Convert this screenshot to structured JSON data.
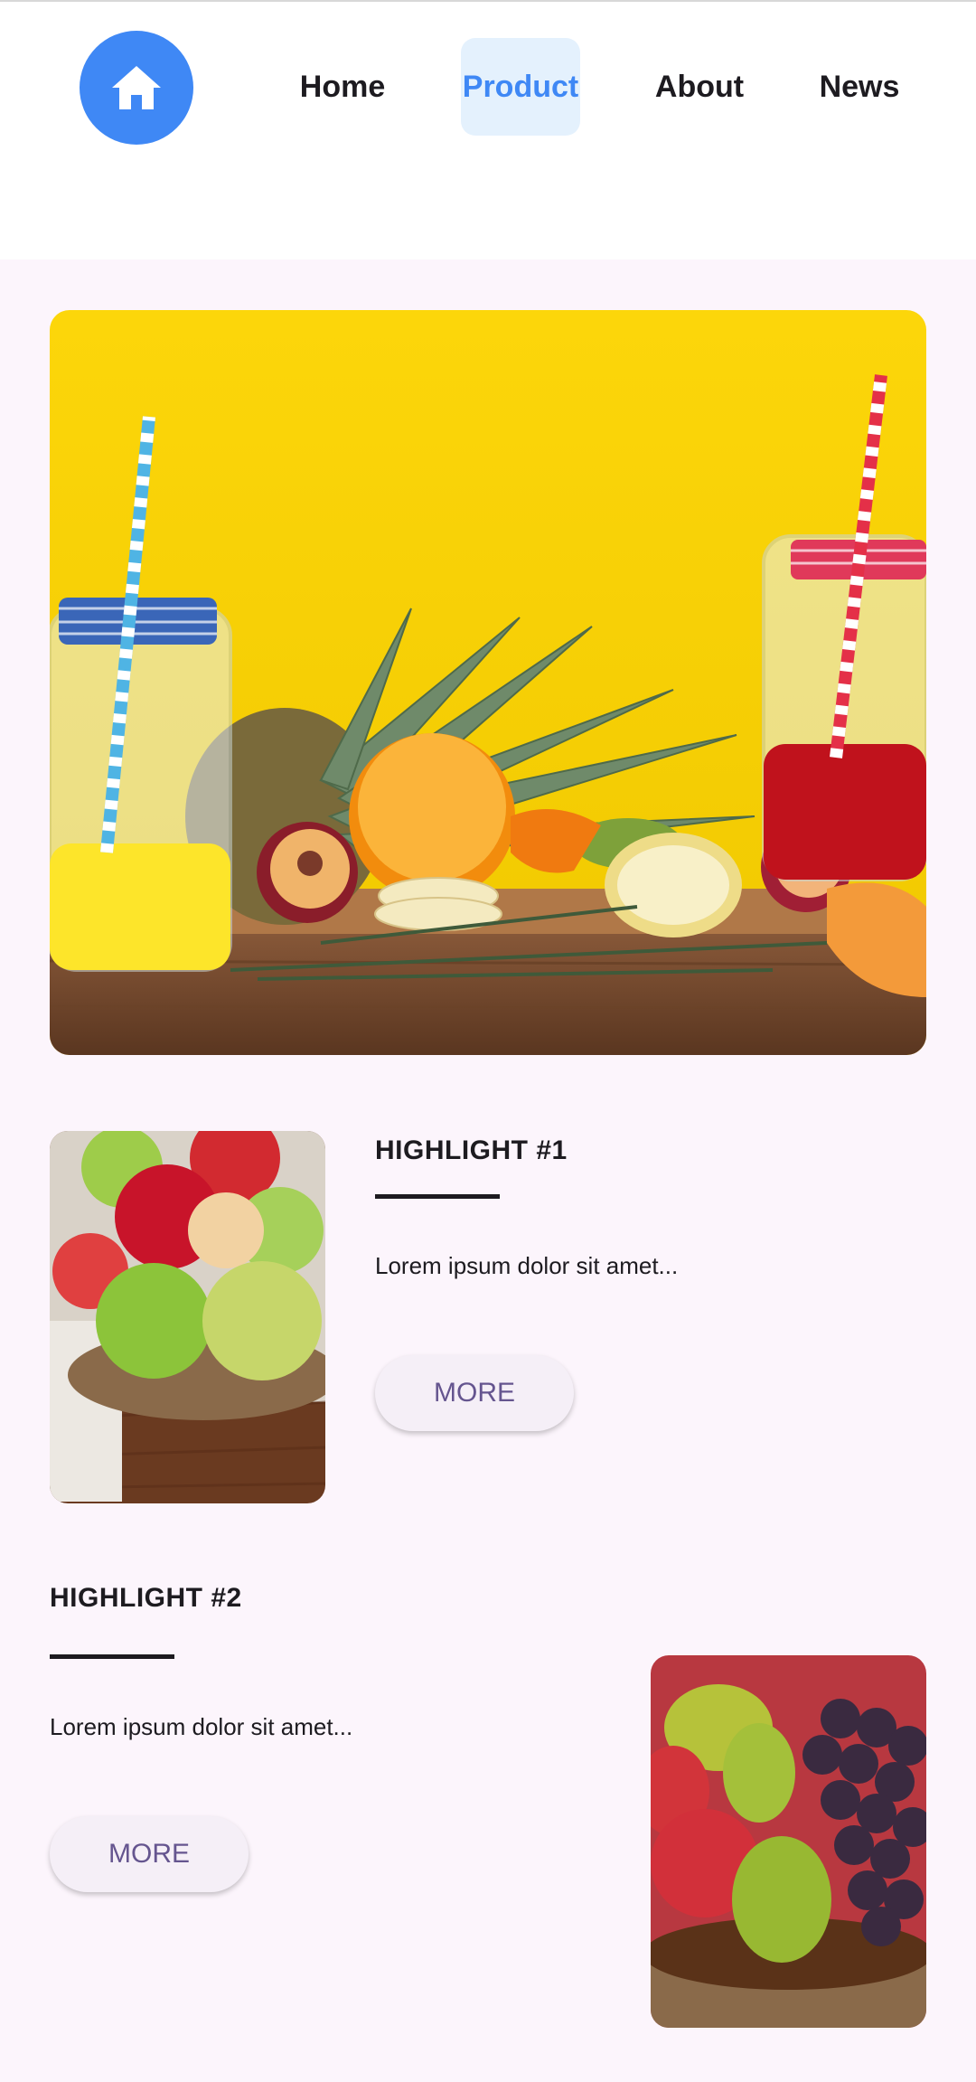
{
  "nav": {
    "logo_icon": "home-icon",
    "items": [
      {
        "label": "Home",
        "active": false
      },
      {
        "label": "Product",
        "active": true
      },
      {
        "label": "About",
        "active": false
      },
      {
        "label": "News",
        "active": false
      }
    ]
  },
  "colors": {
    "accent": "#3f88f5",
    "active_nav_bg": "#e4f1fd",
    "page_bg": "#fcf5fc",
    "button_text": "#65558f"
  },
  "hero": {
    "image": "fruit-juice-jars-on-yellow-background"
  },
  "highlights": [
    {
      "title": "HIGHLIGHT #1",
      "body": "Lorem ipsum dolor sit amet...",
      "button": "MORE",
      "image": "apples-in-basket"
    },
    {
      "title": "HIGHLIGHT #2",
      "body": "Lorem ipsum dolor sit amet...",
      "button": "MORE",
      "image": "pears-grapes-basket"
    }
  ]
}
